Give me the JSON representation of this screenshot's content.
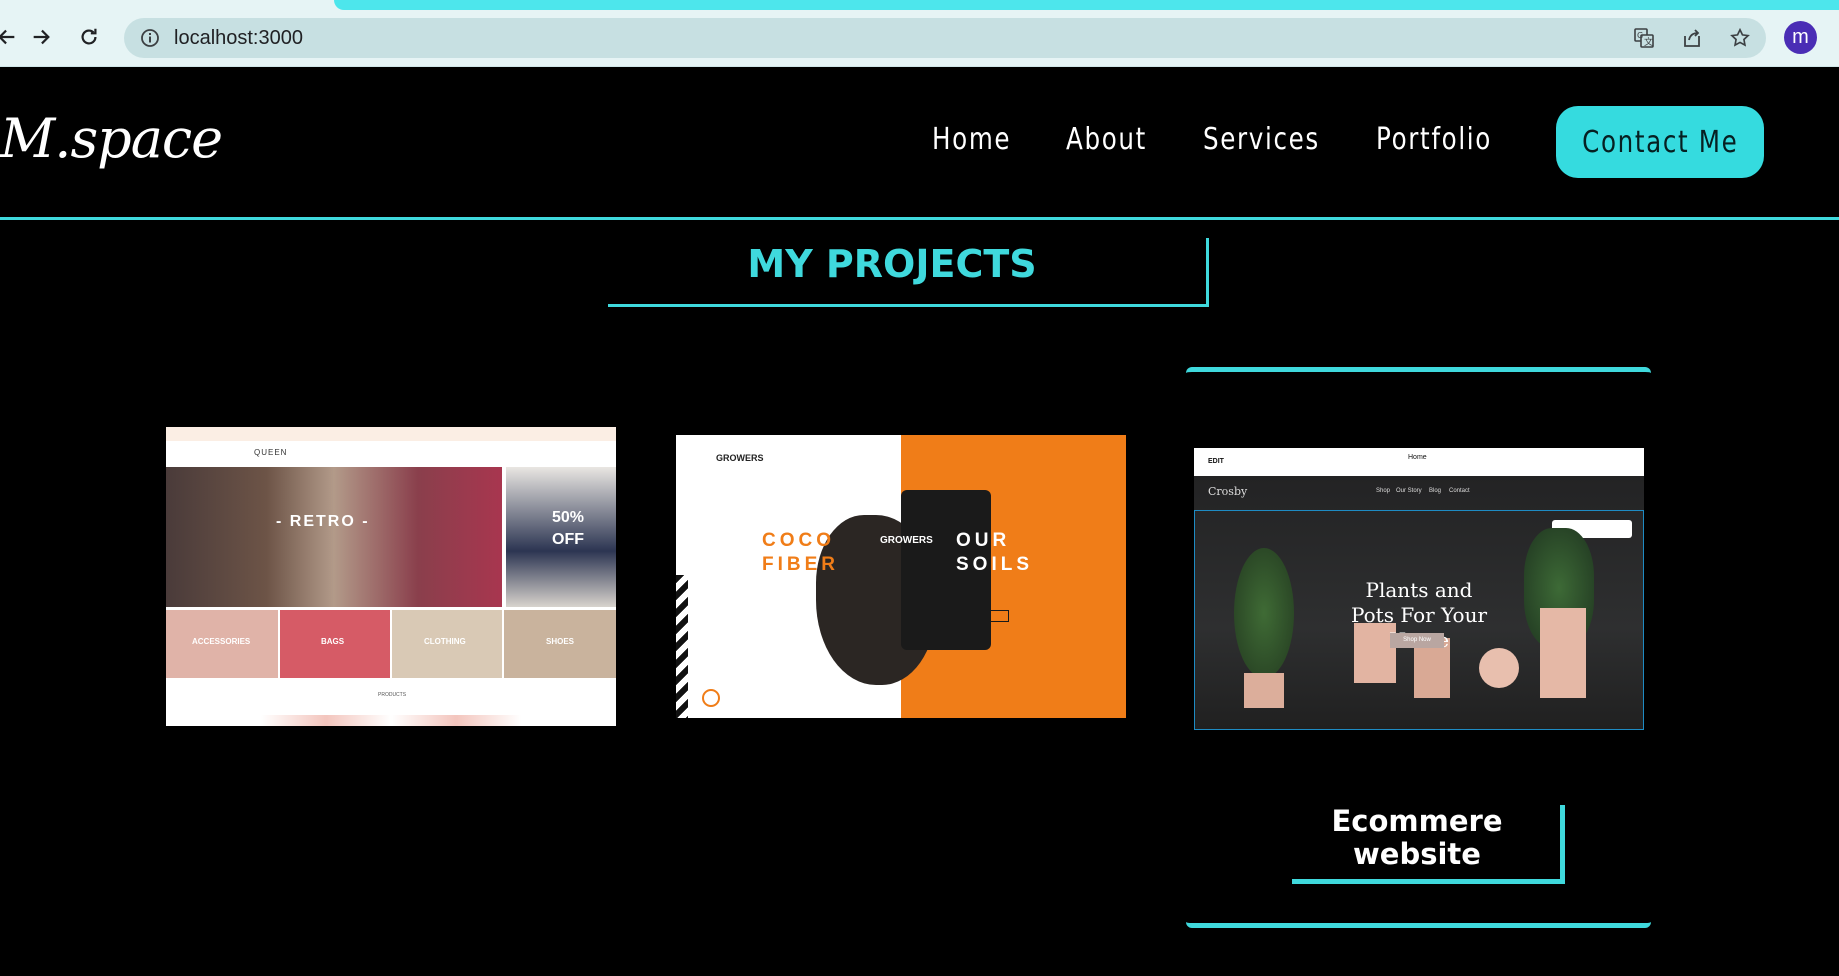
{
  "browser": {
    "url": "localhost:3000",
    "avatar_letter": "m",
    "icons": [
      "back-arrow-icon",
      "forward-arrow-icon",
      "reload-icon",
      "info-icon",
      "translate-icon",
      "share-icon",
      "star-icon"
    ]
  },
  "site": {
    "logo": "M.space",
    "nav": [
      "Home",
      "About",
      "Services",
      "Portfolio"
    ],
    "contact_button": "Contact Me",
    "accent_color": "#3fd9dd"
  },
  "projects": {
    "title": "MY PROJECTS",
    "cards": [
      {
        "thumb": {
          "brand": "QUEEN",
          "hero_text": "- RETRO -",
          "sale_text": "50% OFF",
          "tiles": [
            "ACCESSORIES",
            "BAGS",
            "CLOTHING",
            "SHOES"
          ],
          "section": "PRODUCTS"
        }
      },
      {
        "thumb": {
          "brand": "GROWERS",
          "left_text": "COCO FIBER",
          "right_text": "OUR SOILS",
          "bag_brand": "GROWERS"
        }
      },
      {
        "thumb": {
          "edit": "EDIT",
          "page": "Home",
          "brand": "Crosby",
          "links": [
            "Shop",
            "Our Story",
            "Blog",
            "Contact"
          ],
          "hero": "Plants and Pots For Your Home",
          "button": "Shop Now"
        },
        "label": "Ecommere website"
      }
    ]
  }
}
